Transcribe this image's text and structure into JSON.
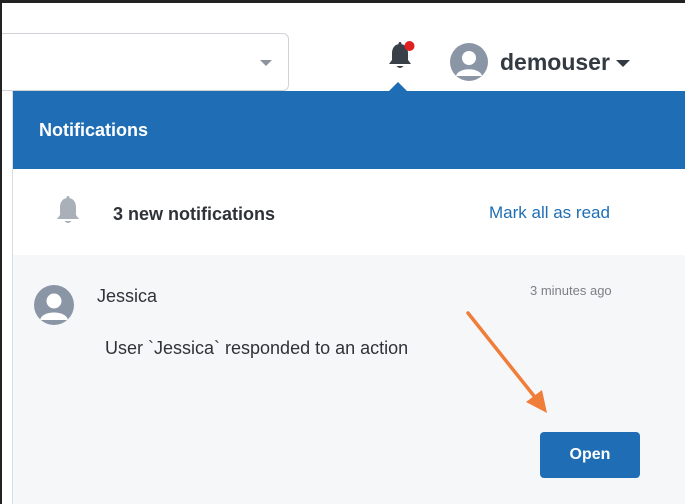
{
  "header": {
    "username": "demouser",
    "has_unread_dot": true
  },
  "notifications_panel": {
    "title": "Notifications",
    "summary": "3 new notifications",
    "mark_all_label": "Mark all as read",
    "items": [
      {
        "sender": "Jessica",
        "time": "3 minutes ago",
        "message": "User `Jessica` responded to an action",
        "button_label": "Open"
      }
    ]
  },
  "colors": {
    "accent": "#1f6eb5",
    "unread_dot": "#e02020",
    "annotation_arrow": "#f07d3a"
  },
  "icons": {
    "top_bell": "bell-icon",
    "summary_bell": "bell-icon",
    "avatar": "user-avatar-icon",
    "dropdown": "chevron-down-icon"
  }
}
